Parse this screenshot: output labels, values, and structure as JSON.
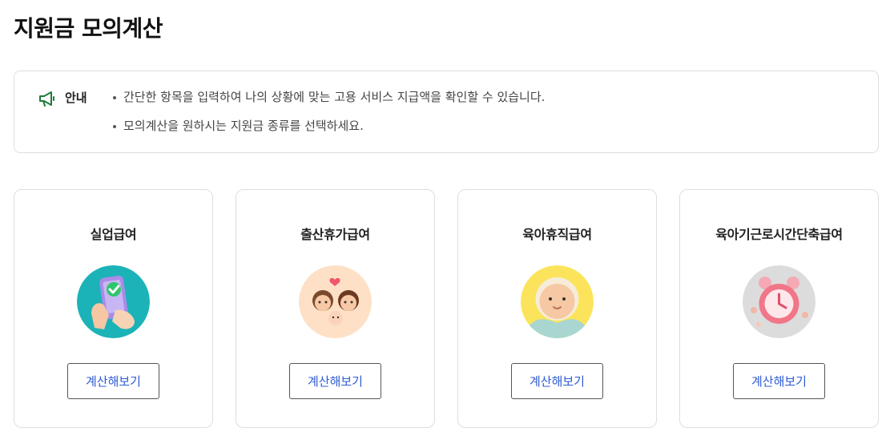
{
  "page": {
    "title": "지원금 모의계산"
  },
  "notice": {
    "icon": "megaphone-icon",
    "label": "안내",
    "items": [
      "간단한 항목을 입력하여 나의 상황에 맞는 고용 서비스 지급액을 확인할 수 있습니다.",
      "모의계산을 원하시는 지원금 종류를 선택하세요."
    ]
  },
  "cards": [
    {
      "title": "실업급여",
      "button": "계산해보기",
      "illustration": "phone-checkmark-icon",
      "color": "#1bb3b8"
    },
    {
      "title": "출산휴가급여",
      "button": "계산해보기",
      "illustration": "family-icon",
      "color": "#fde0c6"
    },
    {
      "title": "육아휴직급여",
      "button": "계산해보기",
      "illustration": "baby-icon",
      "color": "#fbe45b"
    },
    {
      "title": "육아기근로시간단축급여",
      "button": "계산해보기",
      "illustration": "alarm-clock-icon",
      "color": "#dcdcdc"
    }
  ],
  "colors": {
    "accent": "#2d5bd3",
    "notice_icon": "#1f7a3a",
    "border": "#dedede"
  }
}
